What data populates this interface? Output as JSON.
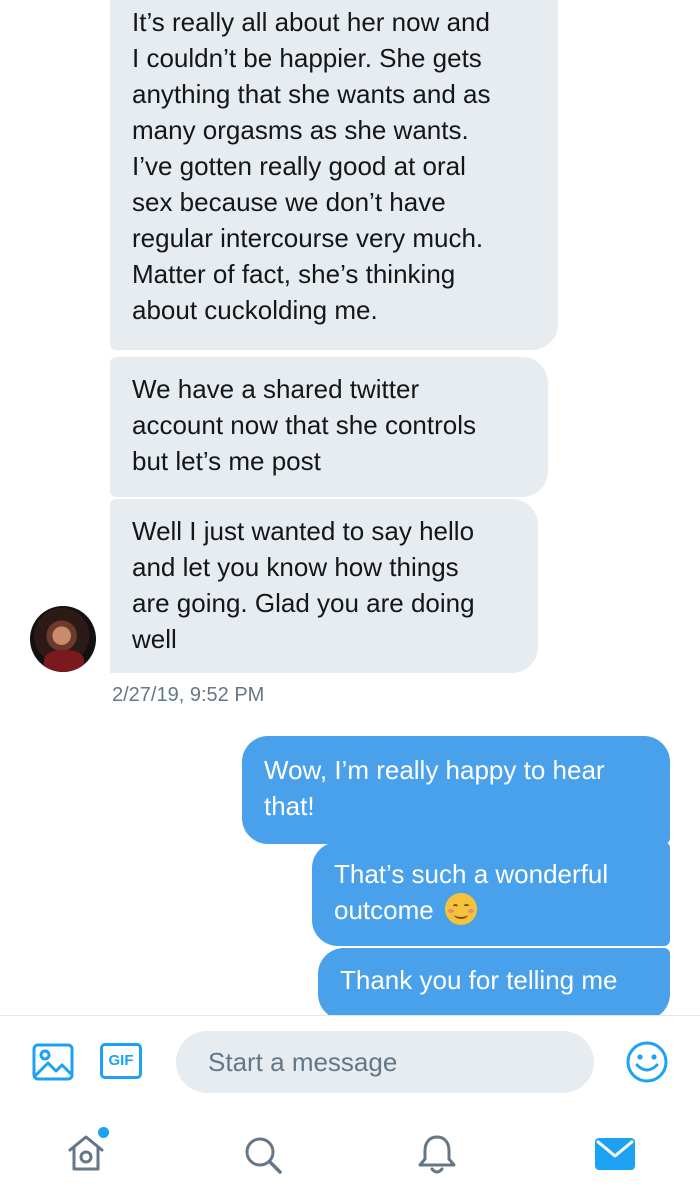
{
  "conversation": {
    "received": [
      "It’s really all about her now and\nI couldn’t be happier. She gets\nanything that she wants and as\nmany orgasms as she wants.\nI’ve gotten really good at oral\nsex because we don’t have\nregular intercourse very much.\nMatter of fact, she’s thinking\nabout cuckolding me.",
      "We have a shared twitter\naccount now that she controls\nbut let’s me post",
      "Well I just wanted to say hello\nand let you know how things\nare going. Glad you are doing\nwell"
    ],
    "timestamp": "2/27/19, 9:52 PM",
    "sent": [
      "Wow, I’m really happy to hear\nthat!",
      "That’s such a wonderful\noutcome",
      "Thank you for telling me"
    ],
    "emoji_name": "smiling-face-emoji"
  },
  "composer": {
    "placeholder": "Start a message",
    "gif_label": "GIF"
  },
  "tabbar": {
    "items": [
      "home-icon",
      "search-icon",
      "notifications-icon",
      "messages-icon"
    ],
    "active": "messages-icon",
    "home_has_notification": true
  },
  "colors": {
    "accent": "#1da1f2",
    "sent_bubble": "#4aa1eb",
    "received_bubble": "#e6ecf0",
    "secondary_text": "#657786"
  }
}
